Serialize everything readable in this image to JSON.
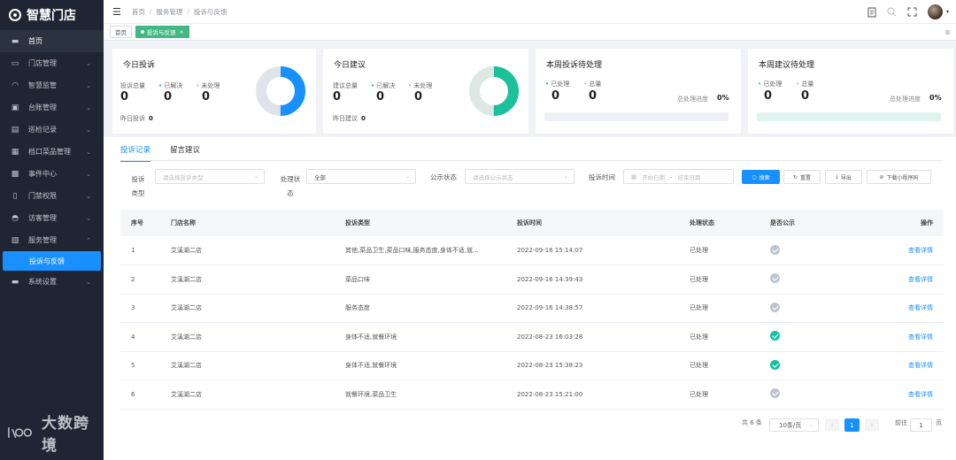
{
  "app": {
    "logo_text": "智慧门店"
  },
  "sidebar": {
    "items": [
      {
        "label": "首页",
        "icon": "monitor-icon"
      },
      {
        "label": "门店管理",
        "icon": "store-icon"
      },
      {
        "label": "智慧监管",
        "icon": "wifi-icon"
      },
      {
        "label": "台账管理",
        "icon": "briefcase-icon"
      },
      {
        "label": "巡检记录",
        "icon": "clipboard-icon"
      },
      {
        "label": "档口菜品管理",
        "icon": "dish-icon"
      },
      {
        "label": "事件中心",
        "icon": "badge-icon"
      },
      {
        "label": "门禁权限",
        "icon": "door-icon"
      },
      {
        "label": "访客管理",
        "icon": "visitor-icon"
      },
      {
        "label": "服务管理",
        "icon": "service-icon"
      },
      {
        "label": "投诉与反馈"
      },
      {
        "label": "系统设置",
        "icon": "settings-icon"
      }
    ]
  },
  "watermark": "大数跨境",
  "breadcrumb": [
    "首页",
    "服务管理",
    "投诉与反馈"
  ],
  "tags": {
    "home": "首页",
    "active": "投诉与反馈"
  },
  "cards": {
    "complaints_today": {
      "title": "今日投诉",
      "total_label": "投诉总量",
      "total": "0",
      "resolved_label": "已解决",
      "resolved": "0",
      "pending_label": "未处理",
      "pending": "0",
      "yesterday_label": "昨日投诉",
      "yesterday": "0",
      "donut_fraction": 0.5
    },
    "suggestions_today": {
      "title": "今日建议",
      "total_label": "建议总量",
      "total": "0",
      "resolved_label": "已解决",
      "resolved": "0",
      "pending_label": "未处理",
      "pending": "0",
      "yesterday_label": "昨日建议",
      "yesterday": "0",
      "donut_fraction": 0.5
    },
    "week_complaints": {
      "title": "本周投诉待处理",
      "processed_label": "已处理",
      "processed": "0",
      "total_label": "总量",
      "total": "0",
      "progress_label": "总处理进度",
      "progress": "0%"
    },
    "week_suggestions": {
      "title": "本周建议待处理",
      "processed_label": "已处理",
      "processed": "0",
      "total_label": "总量",
      "total": "0",
      "progress_label": "总处理进度",
      "progress": "0%"
    }
  },
  "tabs": [
    "投诉记录",
    "留言建议"
  ],
  "filters": {
    "type_label": "投诉类型",
    "type_placeholder": "请选择投诉类型",
    "status_label": "处理状态",
    "status_value": "全部",
    "public_label": "公示状态",
    "public_placeholder": "请选择公示状态",
    "time_label": "投诉时间",
    "start_placeholder": "开始日期",
    "range_sep": "-",
    "end_placeholder": "结束日期",
    "search": "搜索",
    "reset": "重置",
    "export": "导出",
    "download": "下载小程序码"
  },
  "table": {
    "headers": [
      "序号",
      "门店名称",
      "投诉类型",
      "投诉时间",
      "处理状态",
      "是否公示",
      "操作"
    ],
    "rows": [
      {
        "no": "1",
        "store": "艾溪湖二店",
        "type": "其他,菜品卫生,菜品口味,服务态度,身体不适,就...",
        "time": "2022-09-16 15:14:07",
        "status": "已处理",
        "public": false,
        "action": "查看详情"
      },
      {
        "no": "2",
        "store": "艾溪湖二店",
        "type": "菜品口味",
        "time": "2022-09-16 14:39:43",
        "status": "已处理",
        "public": false,
        "action": "查看详情"
      },
      {
        "no": "3",
        "store": "艾溪湖二店",
        "type": "服务态度",
        "time": "2022-09-16 14:38:57",
        "status": "已处理",
        "public": false,
        "action": "查看详情"
      },
      {
        "no": "4",
        "store": "艾溪湖二店",
        "type": "身体不适,就餐环境",
        "time": "2022-08-23 16:03:28",
        "status": "已处理",
        "public": true,
        "action": "查看详情"
      },
      {
        "no": "5",
        "store": "艾溪湖二店",
        "type": "身体不适,就餐环境",
        "time": "2022-08-23 15:38:23",
        "status": "已处理",
        "public": true,
        "action": "查看详情"
      },
      {
        "no": "6",
        "store": "艾溪湖二店",
        "type": "就餐环境,菜品卫生",
        "time": "2022-08-23 15:21:00",
        "status": "已处理",
        "public": false,
        "action": "查看详情"
      }
    ]
  },
  "pagination": {
    "total": "共 6 条",
    "page_size": "10条/页",
    "current": "1",
    "goto_label": "前往",
    "goto_value": "1",
    "page_suffix": "页"
  },
  "colors": {
    "accent": "#1890ff",
    "green": "#42b983",
    "teal": "#13c2a3",
    "sidebar": "#1f2532"
  }
}
